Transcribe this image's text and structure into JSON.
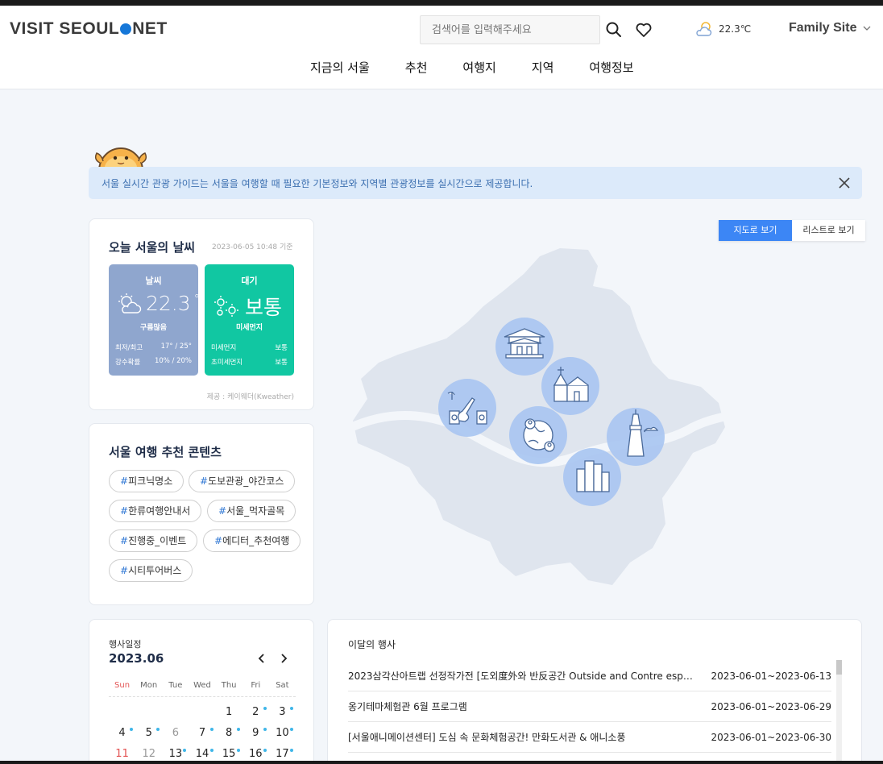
{
  "header": {
    "logo_left": "VISIT SEOUL",
    "logo_right": "NET",
    "search_placeholder": "검색어를 입력해주세요",
    "temperature": "22.3℃",
    "family_site": "Family Site",
    "nav": [
      "지금의 서울",
      "추천",
      "여행지",
      "지역",
      "여행정보"
    ]
  },
  "banner": {
    "text": "서울 실시간 관광 가이드는 서울을 여행할 때 필요한 기본정보와 지역별 관광정보를 실시간으로 제공합니다."
  },
  "weather": {
    "title": "오늘 서울의 날씨",
    "timestamp": "2023-06-05 10:48 기준",
    "weather_tile": {
      "label": "날씨",
      "value": "22.3",
      "unit": "°",
      "condition": "구름많음",
      "rows": [
        {
          "k": "최저/최고",
          "v": "17° / 25°"
        },
        {
          "k": "강수확률",
          "v": "10% / 20%"
        }
      ]
    },
    "air_tile": {
      "label": "대기",
      "value": "보통",
      "condition": "미세먼지",
      "rows": [
        {
          "k": "미세먼지",
          "v": "보통"
        },
        {
          "k": "초미세먼지",
          "v": "보통"
        }
      ]
    },
    "source": "제공 : 케이웨더(Kweather)"
  },
  "recommend": {
    "title": "서울 여행 추천 콘텐츠",
    "tags": [
      "피크닉명소",
      "도보관광_야간코스",
      "한류여행안내서",
      "서울_먹자골목",
      "진행중_이벤트",
      "에디터_추천여행",
      "시티투어버스"
    ]
  },
  "map_view": {
    "map_button": "지도로 보기",
    "list_button": "리스트로 보기"
  },
  "calendar": {
    "label": "행사일정",
    "month": "2023.06",
    "weekdays": [
      "Sun",
      "Mon",
      "Tue",
      "Wed",
      "Thu",
      "Fri",
      "Sat"
    ],
    "days": [
      {
        "d": ""
      },
      {
        "d": ""
      },
      {
        "d": ""
      },
      {
        "d": ""
      },
      {
        "d": "1"
      },
      {
        "d": "2",
        "dot": true
      },
      {
        "d": "3",
        "dot": true
      },
      {
        "d": "4",
        "dot": true
      },
      {
        "d": "5",
        "dot": true
      },
      {
        "d": "6",
        "muted": true
      },
      {
        "d": "7",
        "dot": true
      },
      {
        "d": "8",
        "dot": true
      },
      {
        "d": "9",
        "dot": true
      },
      {
        "d": "10",
        "dot": true
      },
      {
        "d": "11",
        "sun": true
      },
      {
        "d": "12",
        "muted": true
      },
      {
        "d": "13",
        "dot": true
      },
      {
        "d": "14",
        "dot": true
      },
      {
        "d": "15",
        "dot": true
      },
      {
        "d": "16",
        "dot": true
      },
      {
        "d": "17",
        "dot": true
      }
    ]
  },
  "events": {
    "title": "이달의 행사",
    "items": [
      {
        "name": "2023삼각산아트랩 선정작가전 [도외度外와 반反공간 Outside and Contre espac...",
        "date": "2023-06-01~2023-06-13"
      },
      {
        "name": "옹기테마체험관 6월 프로그램",
        "date": "2023-06-01~2023-06-29"
      },
      {
        "name": "[서울애니메이션센터] 도심 속 문화체험공간! 만화도서관 & 애니소풍",
        "date": "2023-06-01~2023-06-30"
      }
    ]
  },
  "colors": {
    "accent": "#3c86f5",
    "weather_tile": "#8fa6ce",
    "air_tile": "#11c7a2",
    "map_land": "#dfe5ee",
    "map_bubble": "#a9c6f1",
    "banner": "#dceafa"
  }
}
